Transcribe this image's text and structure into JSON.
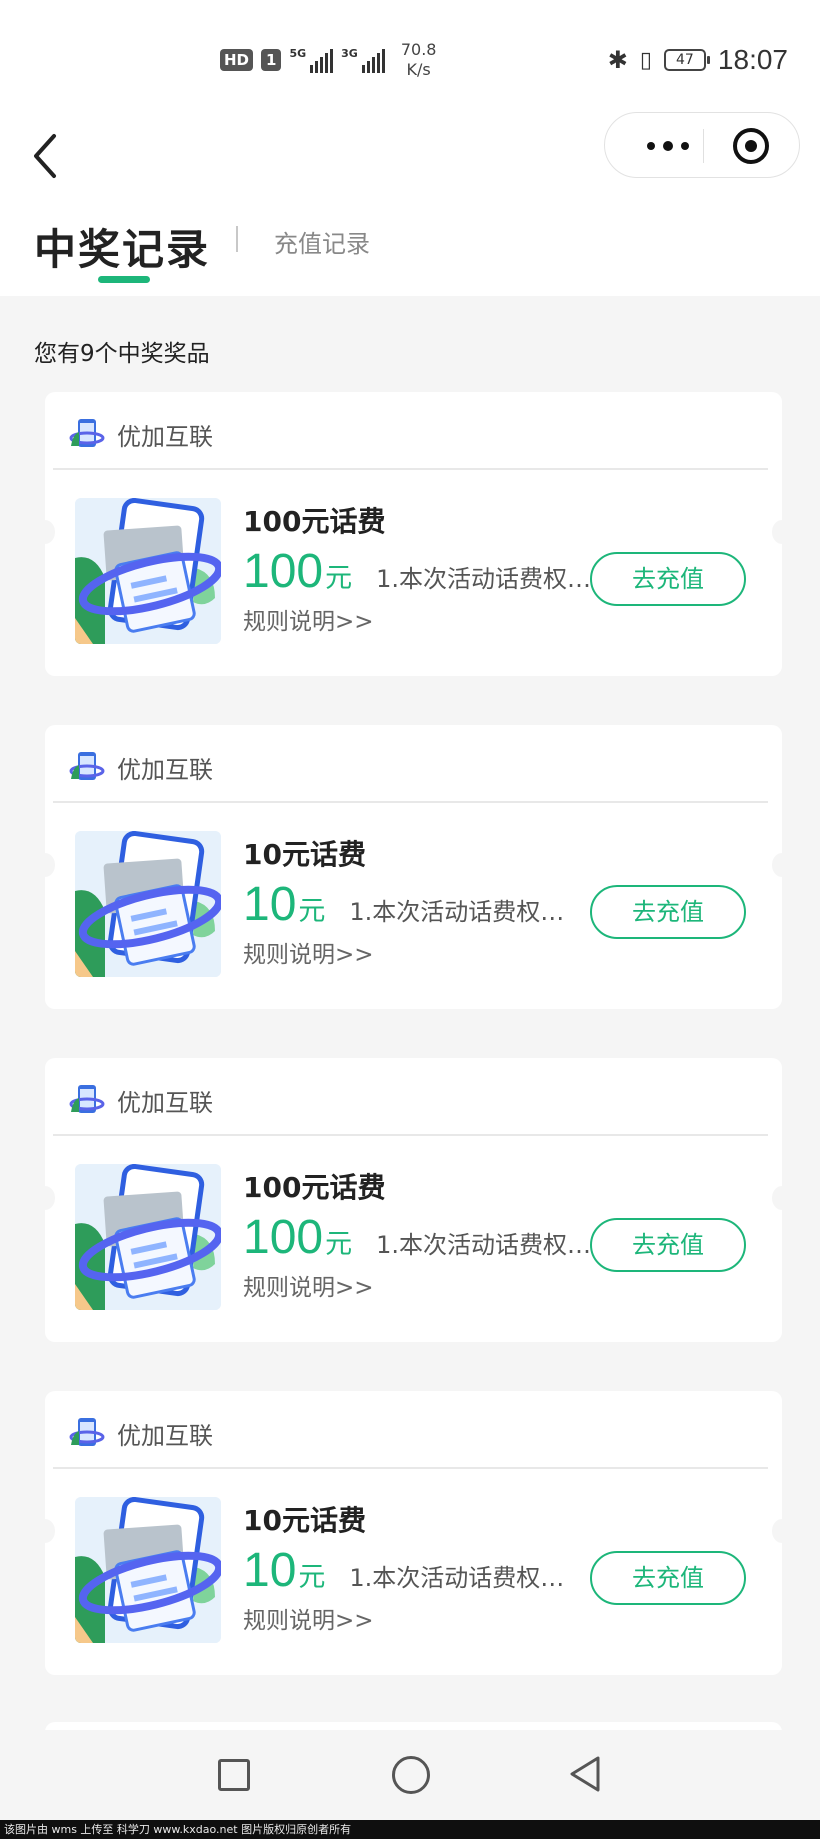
{
  "status_bar": {
    "hd": "HD",
    "sim": "1",
    "net1": "5G",
    "net2": "3G",
    "speed_value": "70.8",
    "speed_unit": "K/s",
    "battery": "47",
    "time": "18:07"
  },
  "tabs": {
    "active": "中奖记录",
    "other": "充值记录"
  },
  "summary": "您有9个中奖奖品",
  "cards": [
    {
      "brand": "优加互联",
      "title": "100元话费",
      "amount": "100",
      "unit": "元",
      "desc": "1.本次活动话费权…",
      "rules": "规则说明>>",
      "button": "去充值"
    },
    {
      "brand": "优加互联",
      "title": "10元话费",
      "amount": "10",
      "unit": "元",
      "desc": "1.本次活动话费权…",
      "rules": "规则说明>>",
      "button": "去充值"
    },
    {
      "brand": "优加互联",
      "title": "100元话费",
      "amount": "100",
      "unit": "元",
      "desc": "1.本次活动话费权…",
      "rules": "规则说明>>",
      "button": "去充值"
    },
    {
      "brand": "优加互联",
      "title": "10元话费",
      "amount": "10",
      "unit": "元",
      "desc": "1.本次活动话费权…",
      "rules": "规则说明>>",
      "button": "去充值"
    }
  ],
  "colors": {
    "accent": "#1db67a",
    "background": "#f5f5f5"
  },
  "icons": {
    "back": "chevron-left-icon",
    "more": "more-dots-icon",
    "close": "target-circle-icon",
    "nav_recent": "square-icon",
    "nav_home": "circle-icon",
    "nav_back": "triangle-back-icon"
  },
  "watermark": "该图片由 wms 上传至 科学刀 www.kxdao.net 图片版权归原创者所有"
}
